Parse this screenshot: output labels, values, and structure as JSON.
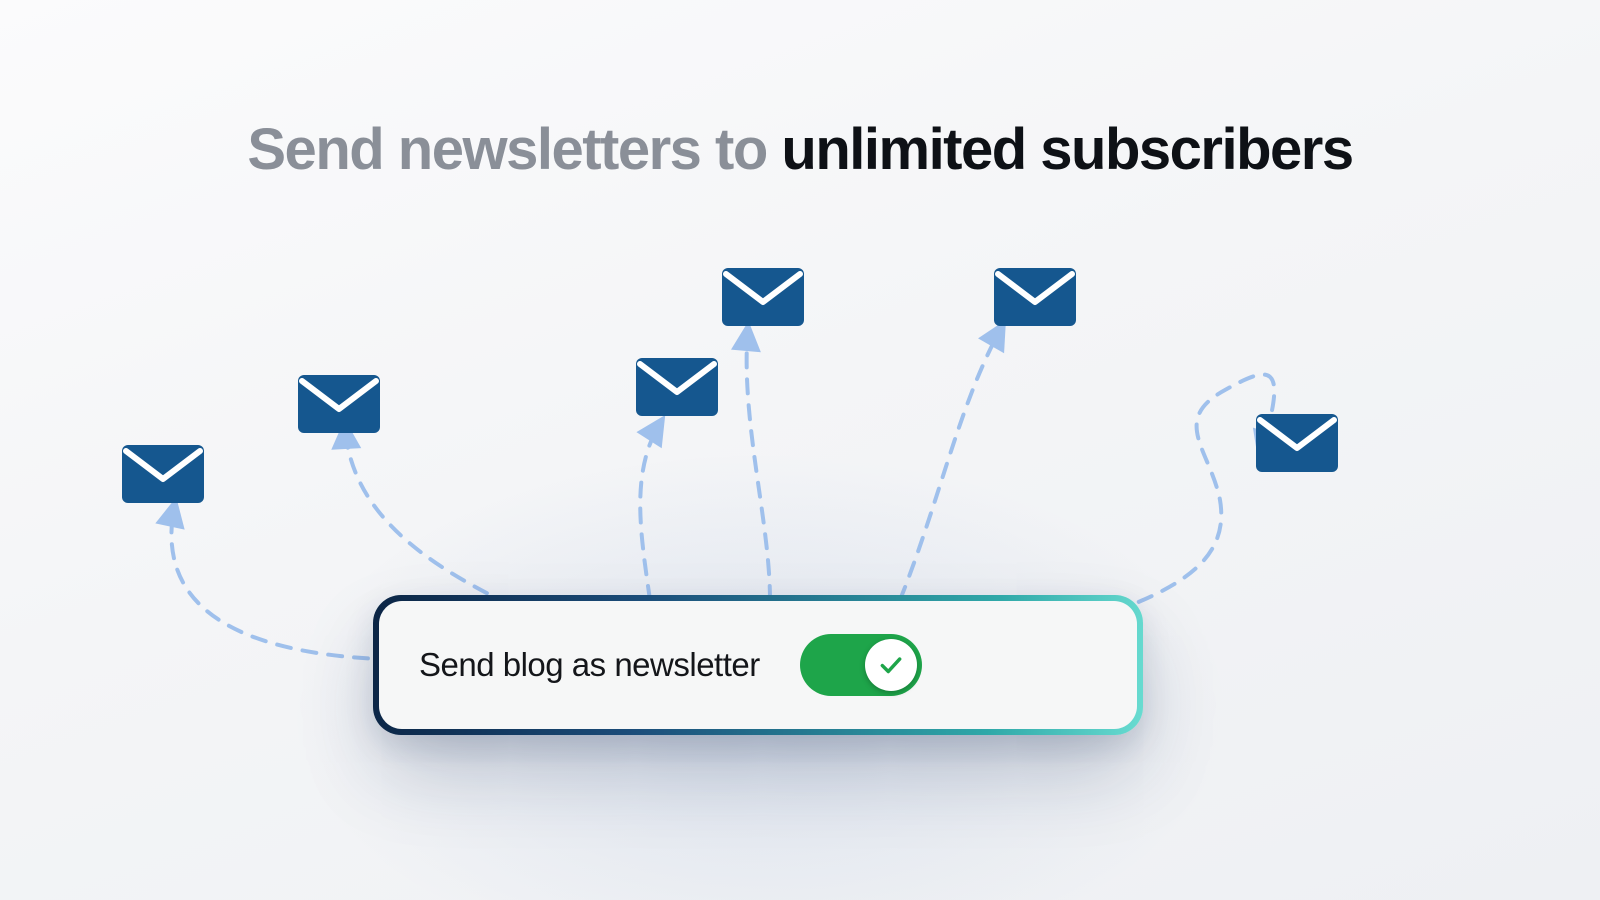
{
  "headline": {
    "muted": "Send newsletters to ",
    "strong": "unlimited subscribers"
  },
  "card": {
    "label": "Send blog as newsletter",
    "toggle_on": true
  },
  "colors": {
    "envelope": "#15578f",
    "arrow": "#9fc0ec",
    "toggle_on": "#1ea54a",
    "check": "#1ea54a"
  }
}
